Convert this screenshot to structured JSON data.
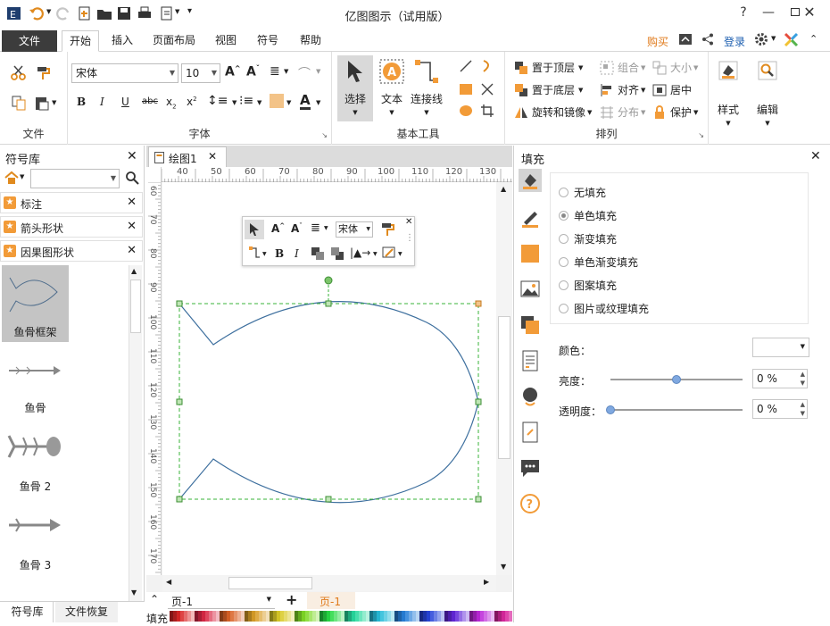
{
  "app": {
    "title": "亿图图示（试用版）"
  },
  "tabs": {
    "file": "文件",
    "items": [
      "开始",
      "插入",
      "页面布局",
      "视图",
      "符号",
      "帮助"
    ],
    "active": "开始"
  },
  "top_right": {
    "buy": "购买",
    "login": "登录"
  },
  "ribbon": {
    "groups": {
      "file": "文件",
      "font": "字体",
      "basic_tools": "基本工具",
      "arrange": "排列"
    },
    "font_name": "宋体",
    "font_size": "10",
    "select": "选择",
    "text": "文本",
    "connector": "连接线",
    "bring_front": "置于顶层",
    "send_back": "置于底层",
    "rotate_mirror": "旋转和镜像",
    "group": "组合",
    "align": "对齐",
    "distribute": "分布",
    "size": "大小",
    "center": "居中",
    "protect": "保护",
    "style": "样式",
    "edit": "编辑"
  },
  "left_panel": {
    "title": "符号库",
    "libraries": [
      "标注",
      "箭头形状",
      "因果图形状"
    ],
    "shapes": [
      "鱼骨框架",
      "鱼骨",
      "鱼骨 2",
      "鱼骨 3"
    ],
    "bottom_tabs": [
      "符号库",
      "文件恢复"
    ]
  },
  "canvas": {
    "doc_tab": "绘图1",
    "ruler_h": [
      "40",
      "50",
      "60",
      "70",
      "80",
      "90",
      "100",
      "110",
      "120",
      "130"
    ],
    "ruler_v": [
      "60",
      "70",
      "80",
      "90",
      "100",
      "110",
      "120",
      "130",
      "140",
      "150",
      "160",
      "170"
    ],
    "float_font": "宋体",
    "page_select": "页-1",
    "page_tab": "页-1",
    "fill_label": "填充"
  },
  "right_panel": {
    "title": "填充",
    "options": [
      "无填充",
      "单色填充",
      "渐变填充",
      "单色渐变填充",
      "图案填充",
      "图片或纹理填充"
    ],
    "selected_option": "单色填充",
    "color_label": "颜色：",
    "brightness_label": "亮度：",
    "brightness_value": "0 %",
    "transparency_label": "透明度：",
    "transparency_value": "0 %",
    "brightness_level": 0.5,
    "transparency_level": 0.0
  },
  "colors": {
    "accent": "#f29b38",
    "selection": "#38b338",
    "shape_stroke": "#3d6f9e",
    "filetab": "#3c3c3c"
  }
}
